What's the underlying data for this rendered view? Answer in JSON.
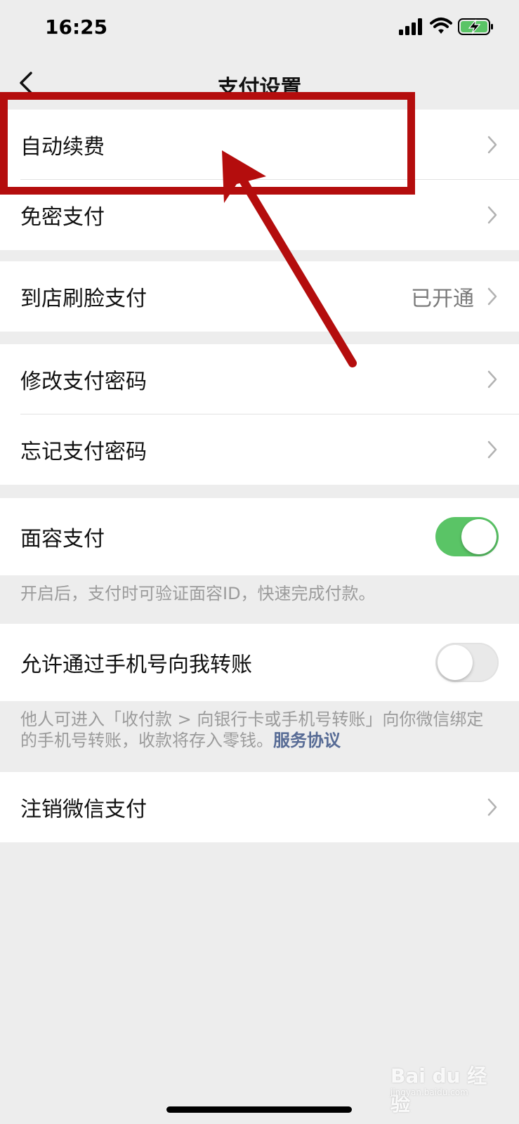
{
  "status": {
    "time": "16:25",
    "battery_color": "#5ac466"
  },
  "nav": {
    "title": "支付设置",
    "back_icon": "chevron-left-icon"
  },
  "groups": {
    "g1": {
      "row1": "自动续费",
      "row2": "免密支付"
    },
    "g2": {
      "row1": "到店刷脸支付",
      "row1_value": "已开通"
    },
    "g3": {
      "row1": "修改支付密码",
      "row2": "忘记支付密码"
    },
    "g4": {
      "row1": "面容支付",
      "toggle_on": true,
      "note": "开启后，支付时可验证面容ID，快速完成付款。"
    },
    "g5": {
      "row1": "允许通过手机号向我转账",
      "toggle_on": false,
      "note": "他人可进入「收付款 > 向银行卡或手机号转账」向你微信绑定的手机号转账，收款将存入零钱。",
      "note_link": "服务协议"
    },
    "g6": {
      "row1": "注销微信支付"
    }
  },
  "colors": {
    "toggle_on": "#5ac466",
    "link": "#576b95",
    "annotation": "#b40d0d"
  },
  "watermark": {
    "text": "Bai du 经验",
    "sub": "jingyan.baidu.com"
  }
}
